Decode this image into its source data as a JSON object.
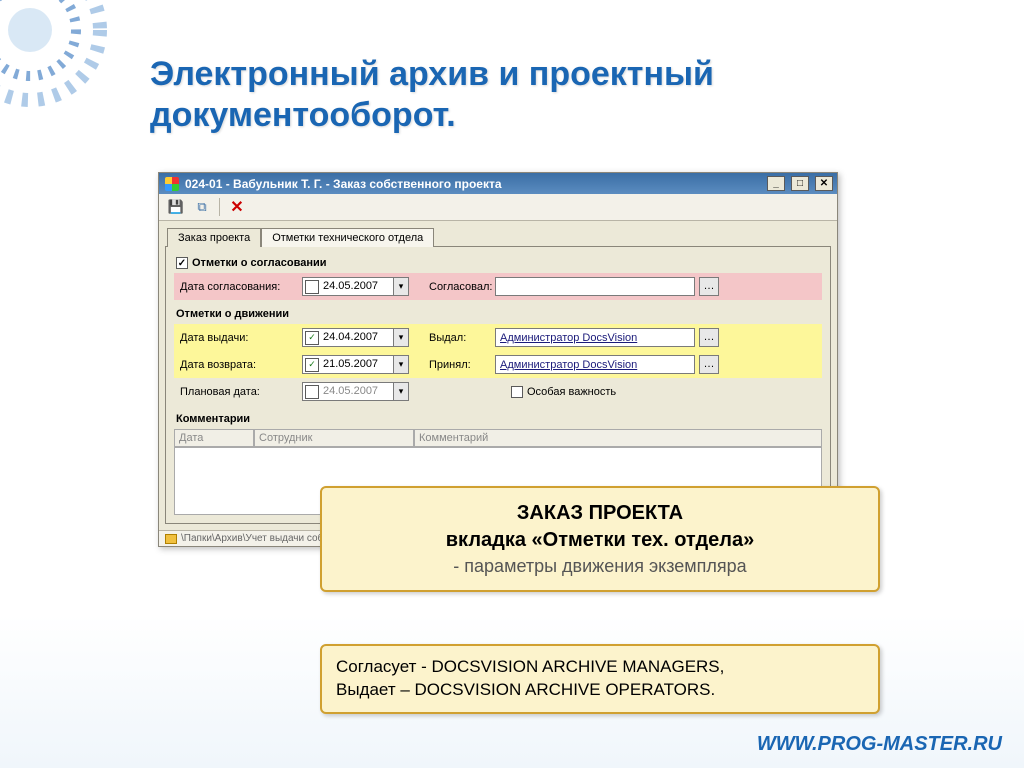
{
  "slide": {
    "title": "Электронный архив  и проектный документооборот."
  },
  "app": {
    "titlebar": "024-01 - Вабульник Т. Г. - Заказ собственного проекта",
    "tabs": {
      "t1": "Заказ проекта",
      "t2": "Отметки технического отдела"
    },
    "approval": {
      "group": "Отметки о согласовании",
      "date_label": "Дата согласования:",
      "date_value": "24.05.2007",
      "approver_label": "Согласовал:",
      "approver_value": ""
    },
    "movement": {
      "group": "Отметки о движении",
      "issued_label": "Дата выдачи:",
      "issued_value": "24.04.2007",
      "issued_by_label": "Выдал:",
      "issued_by_value": "Администратор DocsVision",
      "return_label": "Дата возврата:",
      "return_value": "21.05.2007",
      "accepted_by_label": "Принял:",
      "accepted_by_value": "Администратор DocsVision",
      "planned_label": "Плановая дата:",
      "planned_value": "24.05.2007",
      "priority_label": "Особая важность"
    },
    "comments": {
      "group": "Комментарии",
      "col_date": "Дата",
      "col_emp": "Сотрудник",
      "col_comment": "Комментарий"
    },
    "status_path": "\\Папки\\Архив\\Учет выдачи собственных проектов\\Журнал\\"
  },
  "callout1": {
    "line1": "ЗАКАЗ ПРОЕКТА",
    "line2": "вкладка «Отметки тех. отдела»",
    "line3": "- параметры движения экземпляра"
  },
  "callout2": {
    "line1a": "Согласует - ",
    "line1b": "DOCSVISION ARCHIVE MANAGERS",
    "line2a": "Выдает – ",
    "line2b": "DOCSVISION ARCHIVE OPERATORS"
  },
  "footer": {
    "url": "WWW.PROG-MASTER.RU"
  }
}
